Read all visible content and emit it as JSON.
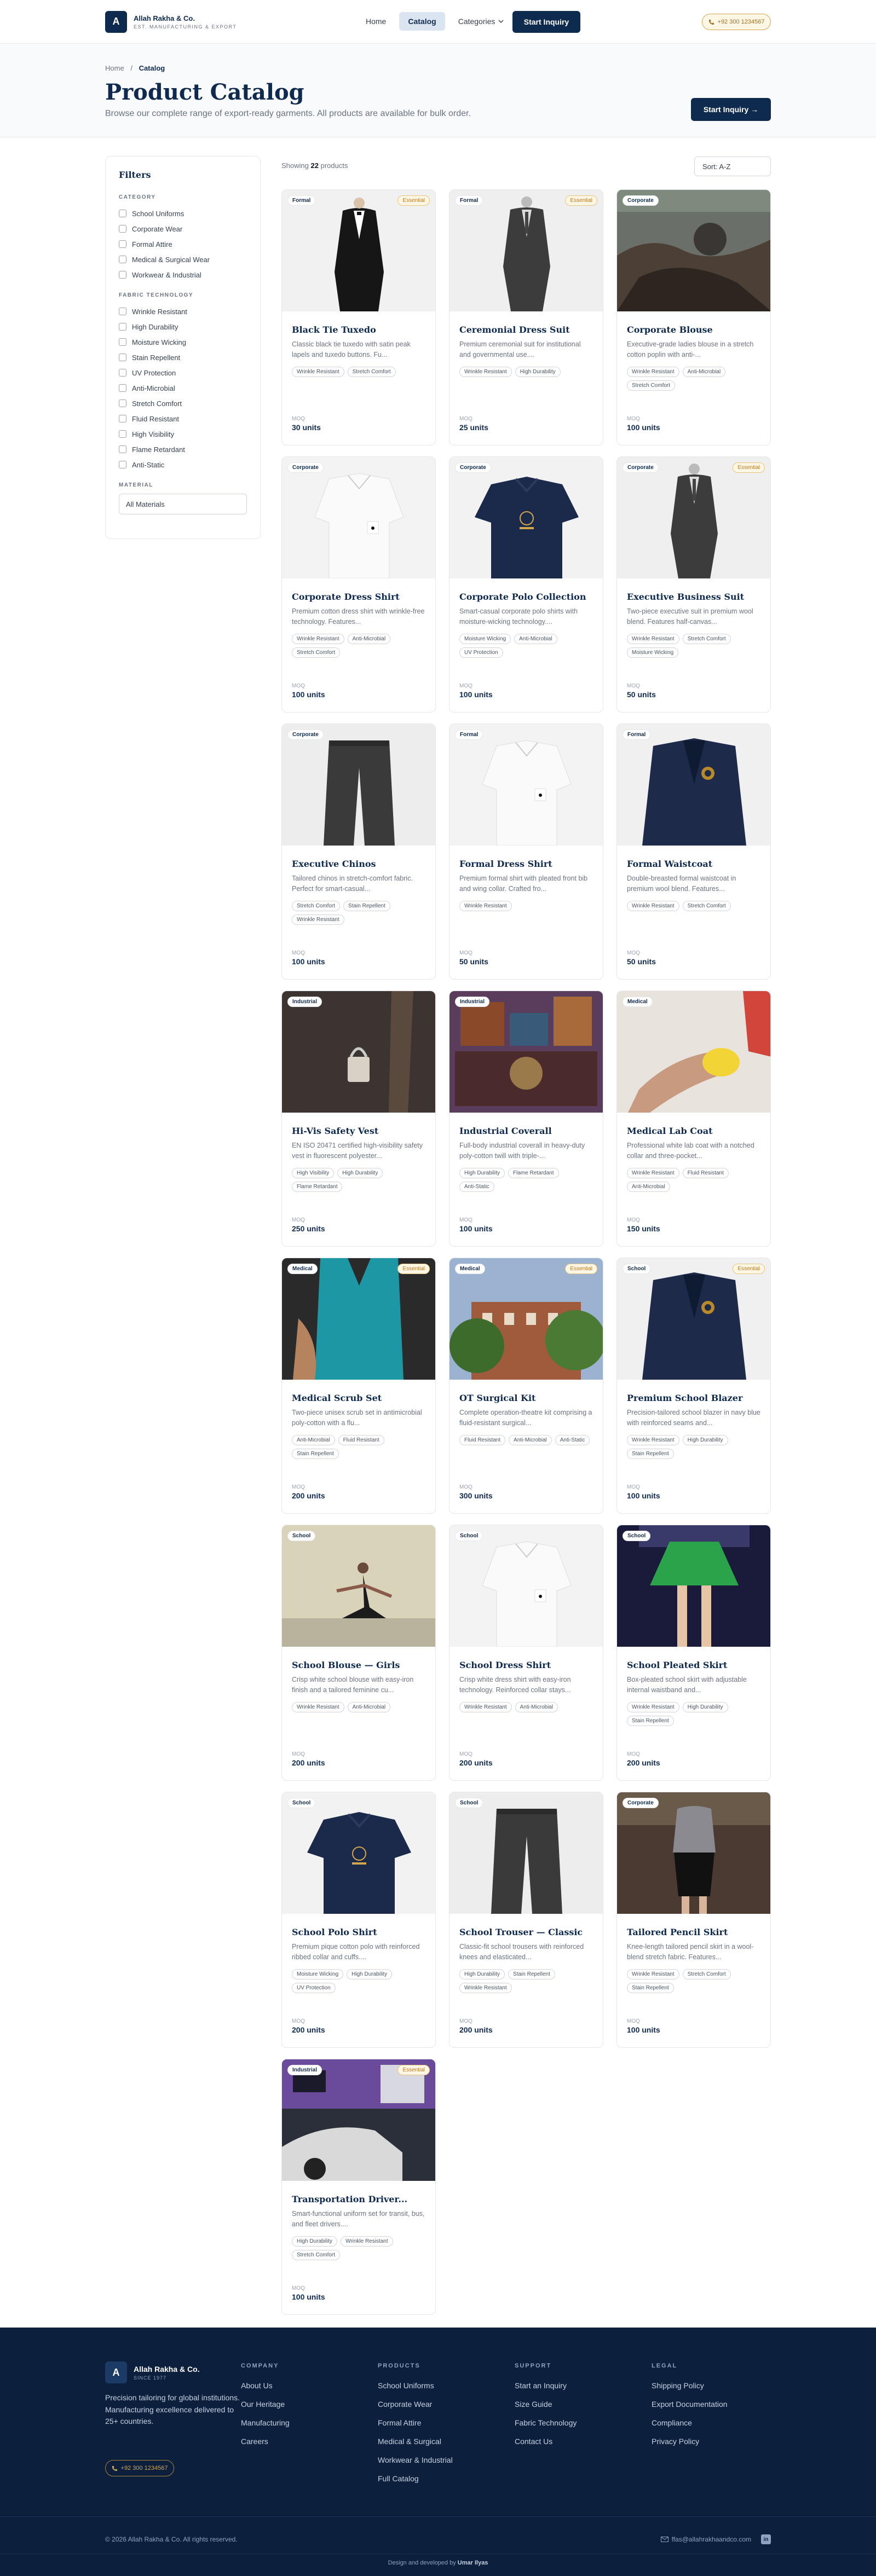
{
  "header": {
    "logo_letter": "A",
    "brand_name": "Allah Rakha & Co.",
    "brand_sub": "EST. MANUFACTURING & EXPORT",
    "nav": [
      "Home",
      "Catalog",
      "Categories"
    ],
    "cta": "Start Inquiry",
    "phone": "+92 300 1234567"
  },
  "hero": {
    "breadcrumb_home": "Home",
    "breadcrumb_sep": "/",
    "breadcrumb_current": "Catalog",
    "title": "Product Catalog",
    "subtitle": "Browse our complete range of export-ready garments. All products are available for bulk order.",
    "cta": "Start Inquiry →"
  },
  "filters": {
    "title": "Filters",
    "category_title": "CATEGORY",
    "categories": [
      "School Uniforms",
      "Corporate Wear",
      "Formal Attire",
      "Medical & Surgical Wear",
      "Workwear & Industrial"
    ],
    "fabric_title": "FABRIC TECHNOLOGY",
    "fabrics": [
      "Wrinkle Resistant",
      "High Durability",
      "Moisture Wicking",
      "Stain Repellent",
      "UV Protection",
      "Anti-Microbial",
      "Stretch Comfort",
      "Fluid Resistant",
      "High Visibility",
      "Flame Retardant",
      "Anti-Static"
    ],
    "material_title": "MATERIAL",
    "material_value": "All Materials"
  },
  "listing": {
    "showing_prefix": "Showing",
    "count": "22",
    "showing_suffix": "products",
    "sort": "Sort: A-Z"
  },
  "products": [
    {
      "cat": "Formal",
      "ess": "Essential",
      "title": "Black Tie Tuxedo",
      "desc": "Classic black tie tuxedo with satin peak lapels and tuxedo buttons. Fu...",
      "tags": [
        "Wrinkle Resistant",
        "Stretch Comfort"
      ],
      "moq_label": "MOQ",
      "moq": "30 units",
      "img": "tuxedo"
    },
    {
      "cat": "Formal",
      "ess": "Essential",
      "title": "Ceremonial Dress Suit",
      "desc": "Premium ceremonial suit for institutional and governmental use....",
      "tags": [
        "Wrinkle Resistant",
        "High Durability"
      ],
      "moq_label": "MOQ",
      "moq": "25 units",
      "img": "suit_grey"
    },
    {
      "cat": "Corporate",
      "ess": "",
      "title": "Corporate Blouse",
      "desc": "Executive-grade ladies blouse in a stretch cotton poplin with anti-...",
      "tags": [
        "Wrinkle Resistant",
        "Anti-Microbial",
        "Stretch Comfort"
      ],
      "moq_label": "MOQ",
      "moq": "100 units",
      "img": "rocks"
    },
    {
      "cat": "Corporate",
      "ess": "",
      "title": "Corporate Dress Shirt",
      "desc": "Premium cotton dress shirt with wrinkle-free technology. Features...",
      "tags": [
        "Wrinkle Resistant",
        "Anti-Microbial",
        "Stretch Comfort"
      ],
      "moq_label": "MOQ",
      "moq": "100 units",
      "img": "shirt"
    },
    {
      "cat": "Corporate",
      "ess": "",
      "title": "Corporate Polo Collection",
      "desc": "Smart-casual corporate polo shirts with moisture-wicking technology....",
      "tags": [
        "Moisture Wicking",
        "Anti-Microbial",
        "UV Protection"
      ],
      "moq_label": "MOQ",
      "moq": "100 units",
      "img": "polo"
    },
    {
      "cat": "Corporate",
      "ess": "Essential",
      "title": "Executive Business Suit",
      "desc": "Two-piece executive suit in premium wool blend. Features half-canvas...",
      "tags": [
        "Wrinkle Resistant",
        "Stretch Comfort",
        "Moisture Wicking"
      ],
      "moq_label": "MOQ",
      "moq": "50 units",
      "img": "suit_grey"
    },
    {
      "cat": "Corporate",
      "ess": "",
      "title": "Executive Chinos",
      "desc": "Tailored chinos in stretch-comfort fabric. Perfect for smart-casual...",
      "tags": [
        "Stretch Comfort",
        "Stain Repellent",
        "Wrinkle Resistant"
      ],
      "moq_label": "MOQ",
      "moq": "100 units",
      "img": "trousers"
    },
    {
      "cat": "Formal",
      "ess": "",
      "title": "Formal Dress Shirt",
      "desc": "Premium formal shirt with pleated front bib and wing collar. Crafted fro...",
      "tags": [
        "Wrinkle Resistant"
      ],
      "moq_label": "MOQ",
      "moq": "50 units",
      "img": "shirt"
    },
    {
      "cat": "Formal",
      "ess": "",
      "title": "Formal Waistcoat",
      "desc": "Double-breasted formal waistcoat in premium wool blend. Features...",
      "tags": [
        "Wrinkle Resistant",
        "Stretch Comfort"
      ],
      "moq_label": "MOQ",
      "moq": "50 units",
      "img": "blazer"
    },
    {
      "cat": "Industrial",
      "ess": "",
      "title": "Hi-Vis Safety Vest",
      "desc": "EN ISO 20471 certified high-visibility safety vest in fluorescent polyester...",
      "tags": [
        "High Visibility",
        "High Durability",
        "Flame Retardant"
      ],
      "moq_label": "MOQ",
      "moq": "250 units",
      "img": "lock"
    },
    {
      "cat": "Industrial",
      "ess": "",
      "title": "Industrial Coverall",
      "desc": "Full-body industrial coverall in heavy-duty poly-cotton twill with triple-...",
      "tags": [
        "High Durability",
        "Flame Retardant",
        "Anti-Static"
      ],
      "moq_label": "MOQ",
      "moq": "100 units",
      "img": "mural"
    },
    {
      "cat": "Medical",
      "ess": "",
      "title": "Medical Lab Coat",
      "desc": "Professional white lab coat with a notched collar and three-pocket...",
      "tags": [
        "Wrinkle Resistant",
        "Fluid Resistant",
        "Anti-Microbial"
      ],
      "moq_label": "MOQ",
      "moq": "150 units",
      "img": "lemon"
    },
    {
      "cat": "Medical",
      "ess": "Essential",
      "title": "Medical Scrub Set",
      "desc": "Two-piece unisex scrub set in antimicrobial poly-cotton with a flu...",
      "tags": [
        "Anti-Microbial",
        "Fluid Resistant",
        "Stain Repellent"
      ],
      "moq_label": "MOQ",
      "moq": "200 units",
      "img": "scrubs"
    },
    {
      "cat": "Medical",
      "ess": "Essential",
      "title": "OT Surgical Kit",
      "desc": "Complete operation-theatre kit comprising a fluid-resistant surgical...",
      "tags": [
        "Fluid Resistant",
        "Anti-Microbial",
        "Anti-Static"
      ],
      "moq_label": "MOQ",
      "moq": "300 units",
      "img": "building"
    },
    {
      "cat": "School",
      "ess": "Essential",
      "title": "Premium School Blazer",
      "desc": "Precision-tailored school blazer in navy blue with reinforced seams and...",
      "tags": [
        "Wrinkle Resistant",
        "High Durability",
        "Stain Repellent"
      ],
      "moq_label": "MOQ",
      "moq": "100 units",
      "img": "blazer"
    },
    {
      "cat": "School",
      "ess": "",
      "title": "School Blouse — Girls",
      "desc": "Crisp white school blouse with easy-iron finish and a tailored feminine cu...",
      "tags": [
        "Wrinkle Resistant",
        "Anti-Microbial"
      ],
      "moq_label": "MOQ",
      "moq": "200 units",
      "img": "yoga"
    },
    {
      "cat": "School",
      "ess": "",
      "title": "School Dress Shirt",
      "desc": "Crisp white dress shirt with easy-iron technology. Reinforced collar stays...",
      "tags": [
        "Wrinkle Resistant",
        "Anti-Microbial"
      ],
      "moq_label": "MOQ",
      "moq": "200 units",
      "img": "shirt"
    },
    {
      "cat": "School",
      "ess": "",
      "title": "School Pleated Skirt",
      "desc": "Box-pleated school skirt with adjustable internal waistband and...",
      "tags": [
        "Wrinkle Resistant",
        "High Durability",
        "Stain Repellent"
      ],
      "moq_label": "MOQ",
      "moq": "200 units",
      "img": "skirt"
    },
    {
      "cat": "School",
      "ess": "",
      "title": "School Polo Shirt",
      "desc": "Premium pique cotton polo with reinforced ribbed collar and cuffs....",
      "tags": [
        "Moisture Wicking",
        "High Durability",
        "UV Protection"
      ],
      "moq_label": "MOQ",
      "moq": "200 units",
      "img": "polo"
    },
    {
      "cat": "School",
      "ess": "",
      "title": "School Trouser — Classic",
      "desc": "Classic-fit school trousers with reinforced knees and elasticated...",
      "tags": [
        "High Durability",
        "Stain Repellent",
        "Wrinkle Resistant"
      ],
      "moq_label": "MOQ",
      "moq": "200 units",
      "img": "trousers"
    },
    {
      "cat": "Corporate",
      "ess": "",
      "title": "Tailored Pencil Skirt",
      "desc": "Knee-length tailored pencil skirt in a wool-blend stretch fabric. Features...",
      "tags": [
        "Wrinkle Resistant",
        "Stretch Comfort",
        "Stain Repellent"
      ],
      "moq_label": "MOQ",
      "moq": "100 units",
      "img": "pencil"
    },
    {
      "cat": "Industrial",
      "ess": "Essential",
      "title": "Transportation Driver...",
      "desc": "Smart-functional uniform set for transit, bus, and fleet drivers....",
      "tags": [
        "High Durability",
        "Wrinkle Resistant",
        "Stretch Comfort"
      ],
      "moq_label": "MOQ",
      "moq": "100 units",
      "img": "car"
    }
  ],
  "footer": {
    "brand_name": "Allah Rakha & Co.",
    "brand_sub": "SINCE 1977",
    "tagline": "Precision tailoring for global institutions. Manufacturing excellence delivered to 25+ countries.",
    "phone": "+92 300 1234567",
    "columns": [
      {
        "title": "COMPANY",
        "links": [
          "About Us",
          "Our Heritage",
          "Manufacturing",
          "Careers"
        ]
      },
      {
        "title": "PRODUCTS",
        "links": [
          "School Uniforms",
          "Corporate Wear",
          "Formal Attire",
          "Medical & Surgical",
          "Workwear & Industrial",
          "Full Catalog"
        ]
      },
      {
        "title": "SUPPORT",
        "links": [
          "Start an Inquiry",
          "Size Guide",
          "Fabric Technology",
          "Contact Us"
        ]
      },
      {
        "title": "LEGAL",
        "links": [
          "Shipping Policy",
          "Export Documentation",
          "Compliance",
          "Privacy Policy"
        ]
      }
    ],
    "copyright": "© 2026 Allah Rakha & Co. All rights reserved.",
    "email": "ffas@allahrakhaandco.com",
    "linkedin": "in",
    "credit_prefix": "Design and developed by",
    "credit_name": "Umar Ilyas"
  }
}
